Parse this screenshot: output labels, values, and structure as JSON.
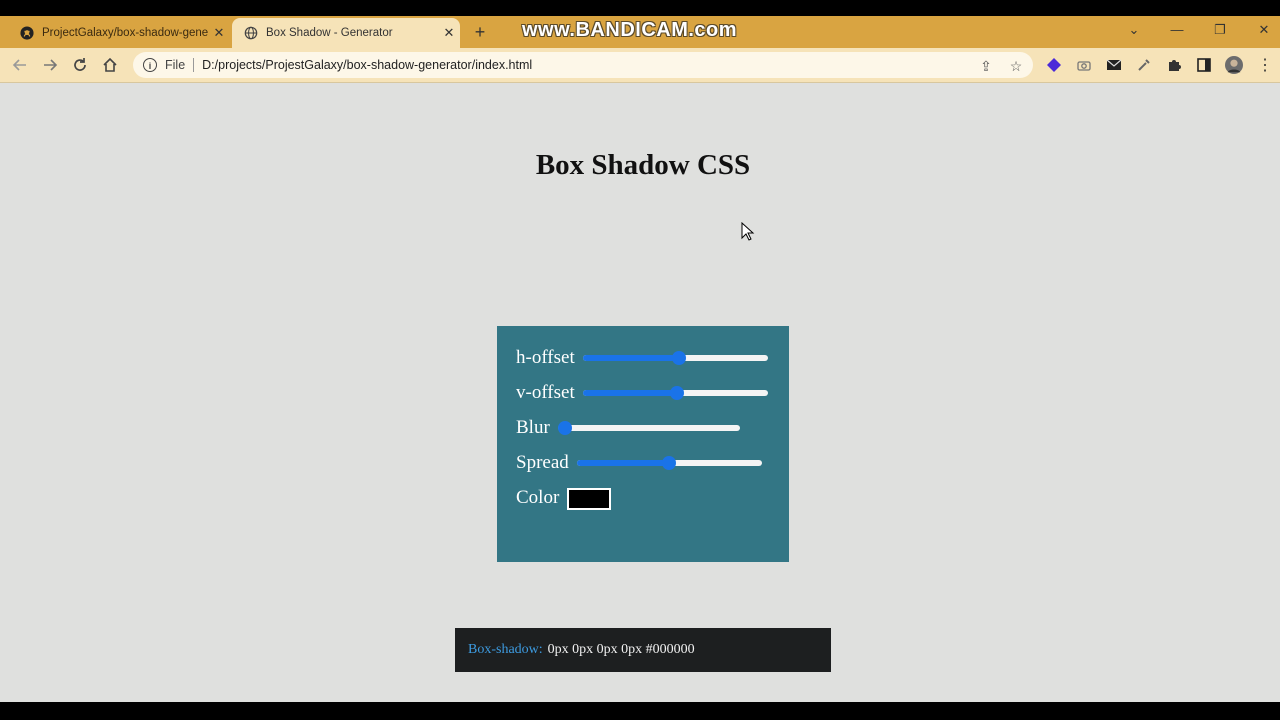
{
  "browser": {
    "tabs": [
      {
        "title": "ProjectGalaxy/box-shadow-gene",
        "active": false,
        "icon": "github-icon"
      },
      {
        "title": "Box Shadow - Generator",
        "active": true,
        "icon": "globe-icon"
      }
    ],
    "watermark": "www.BANDICAM.com",
    "omnibox": {
      "scheme_label": "File",
      "url": "D:/projects/ProjestGalaxy/box-shadow-generator/index.html"
    },
    "accent": "#d9a441"
  },
  "page": {
    "title": "Box Shadow CSS",
    "panel_color": "#337685",
    "controls": [
      {
        "label": "h-offset",
        "value_fraction": 0.52
      },
      {
        "label": "v-offset",
        "value_fraction": 0.51
      },
      {
        "label": "Blur",
        "value_fraction": 0.0
      },
      {
        "label": "Spread",
        "value_fraction": 0.5
      }
    ],
    "color_label": "Color",
    "color_value": "#000000",
    "output": {
      "property": "Box-shadow:",
      "value": "0px 0px 0px 0px #000000"
    }
  }
}
